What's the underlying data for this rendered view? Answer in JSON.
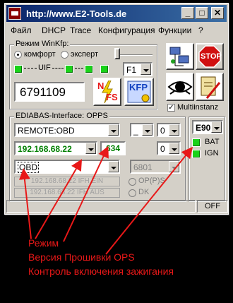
{
  "window": {
    "title": "http://www.E2-Tools.de",
    "min_glyph": "_",
    "max_glyph": "□",
    "close_glyph": "✕"
  },
  "menu": [
    "Файл",
    "DHCP",
    "Trace",
    "Конфигурация",
    "Функции",
    "?"
  ],
  "winkfp": {
    "legend": "Режим WinKfp:",
    "mode_comfort": "комфорт",
    "mode_expert": "эксперт",
    "uif_label": "UIF",
    "key_select": "F1",
    "number": "6791109",
    "nfs_text": [
      "N",
      "FS"
    ],
    "kfp_text": "KFP"
  },
  "tools": {
    "stop_text": "STOP",
    "multiinstanz_label": "Multiinstanz",
    "multiinstanz_checked": true
  },
  "ediabas": {
    "legend": "EDIABAS-Interface: OPPS",
    "interface": "REMOTE:OBD",
    "opt1": "_",
    "opt2": "0",
    "ip": "192.168.68.22",
    "firmware": "634",
    "opt3": "0",
    "mode": "OBD",
    "port": "6801",
    "btn_ifh_ein": "192.168.68.22 IFH EIN",
    "btn_ifh_aus": "192.168.68.22 IFH AUS",
    "radio_opps": "OP(P)S",
    "radio_dk": "DK"
  },
  "vehicle": {
    "series": "E90",
    "bat_label": "BAT",
    "ign_label": "IGN"
  },
  "status": {
    "state": "OFF"
  },
  "annotations": [
    "Режим",
    "Версия Прошивки OPS",
    "Контроль включения зажигания"
  ],
  "colors": {
    "led_green": "#19d219",
    "field_green_text": "#008000",
    "annotation_red": "#e81818",
    "titlebar": "#0a246a"
  }
}
